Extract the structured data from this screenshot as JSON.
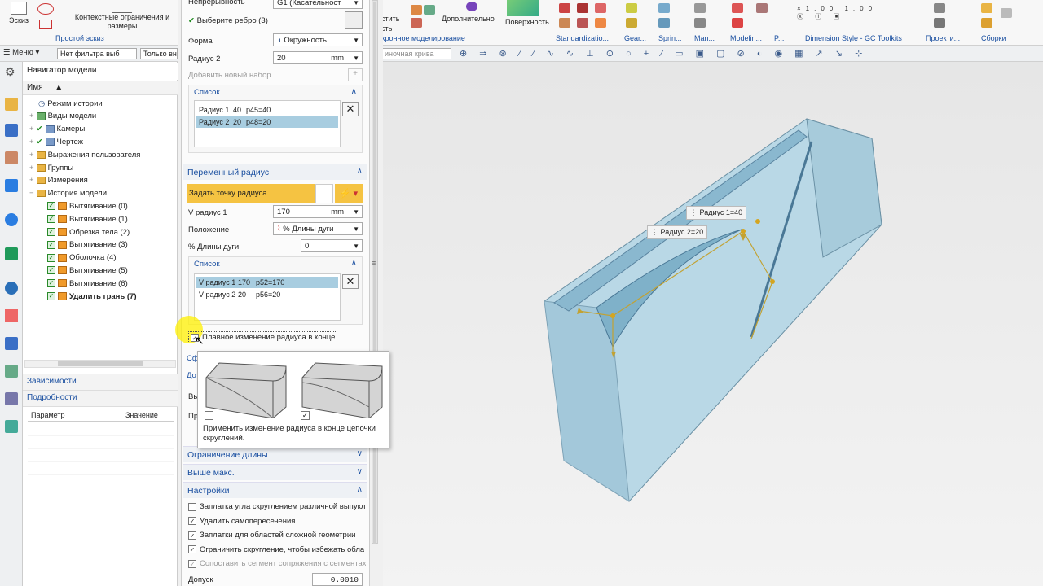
{
  "ribbon_left": {
    "sketch_label": "Эскиз",
    "constraints_label": "Контекстные ограничения и размеры",
    "group_label": "Простой эскиз"
  },
  "ribbon_right": {
    "partial_text_1": "стить",
    "partial_text_2": "сть",
    "additional_label": "Дополнительно",
    "surface_label": "Поверхность",
    "groups": [
      "хронное моделирование",
      "Standardizatio...",
      "Gear...",
      "Sprin...",
      "Man...",
      "Modelin...",
      "P...",
      "Dimension Style - GC Toolkits",
      "Проекти...",
      "Сборки"
    ],
    "curve_filter": "иночная крива"
  },
  "filterbar": {
    "menu": "Меню",
    "filter": "Нет фильтра выб",
    "only": "Только вн"
  },
  "navigator": {
    "title": "Навигатор модели",
    "col_name": "Имя",
    "items": [
      {
        "label": "Режим истории",
        "type": "clock"
      },
      {
        "label": "Виды модели",
        "type": "views"
      },
      {
        "label": "Камеры",
        "type": "camera"
      },
      {
        "label": "Чертеж",
        "type": "drawing"
      },
      {
        "label": "Выражения пользователя",
        "type": "folder"
      },
      {
        "label": "Группы",
        "type": "folder"
      },
      {
        "label": "Измерения",
        "type": "folder"
      },
      {
        "label": "История модели",
        "type": "folder"
      },
      {
        "label": "Вытягивание (0)",
        "type": "feat"
      },
      {
        "label": "Вытягивание (1)",
        "type": "feat"
      },
      {
        "label": "Обрезка тела (2)",
        "type": "feat"
      },
      {
        "label": "Вытягивание (3)",
        "type": "feat"
      },
      {
        "label": "Оболочка (4)",
        "type": "feat"
      },
      {
        "label": "Вытягивание (5)",
        "type": "feat"
      },
      {
        "label": "Вытягивание (6)",
        "type": "feat"
      },
      {
        "label": "Удалить грань (7)",
        "type": "feat"
      }
    ],
    "dependencies": "Зависимости",
    "details": "Подробности",
    "details_cols": [
      "Параметр",
      "Значение"
    ]
  },
  "dialog": {
    "continuity_label": "Непрерывность",
    "continuity_value": "G1 (Касательност",
    "select_edge": "Выберите ребро (3)",
    "shape_label": "Форма",
    "shape_value": "Окружность",
    "radius2_label": "Радиус 2",
    "radius2_value": "20",
    "unit_mm": "mm",
    "add_new_set": "Добавить новый набор",
    "list_header": "Список",
    "list_rows": [
      [
        "Радиус 1",
        "40",
        "p45=40"
      ],
      [
        "Радиус 2",
        "20",
        "p48=20"
      ]
    ],
    "var_radius_section": "Переменный радиус",
    "set_radius_point": "Задать точку радиуса",
    "v_radius1_label": "V радиус 1",
    "v_radius1_value": "170",
    "position_label": "Положение",
    "position_value": "% Длины дуги",
    "arc_pct_label": "% Длины дуги",
    "arc_pct_value": "0",
    "list2_header": "Список",
    "list2_rows": [
      [
        "V радиус 1",
        "170",
        "p52=170"
      ],
      [
        "V радиус 2",
        "20",
        "p56=20"
      ]
    ],
    "smooth_change": "Плавное изменение радиуса в конце",
    "partial_1": "Сф",
    "partial_2": "До",
    "partial_3": "Вы",
    "partial_4": "Пр",
    "length_limit": "Ограничение длины",
    "above_max": "Выше макс.",
    "settings": "Настройки",
    "settings_items": [
      {
        "label": "Заплатка угла скруглением различной выпукл",
        "checked": false,
        "disabled": false
      },
      {
        "label": "Удалить самопересечения",
        "checked": true,
        "disabled": false
      },
      {
        "label": "Заплатки для областей сложной геометрии",
        "checked": true,
        "disabled": false
      },
      {
        "label": "Ограничить скругление, чтобы избежать обла",
        "checked": true,
        "disabled": false
      },
      {
        "label": "Сопоставить сегмент сопряжения с сегментах",
        "checked": true,
        "disabled": true
      }
    ],
    "tolerance_label": "Допуск",
    "tolerance_value": "0.0010"
  },
  "tooltip": {
    "text": "Применить изменение радиуса в конце цепочки скруглений."
  },
  "viewport": {
    "label_r1": "Радиус 1=40",
    "label_r2": "Радиус 2=20"
  },
  "colors": {
    "accent": "#1a4fa0",
    "selection": "#a8cde0",
    "highlight_yellow": "#f5c342",
    "model_face": "#a9cfe0"
  }
}
